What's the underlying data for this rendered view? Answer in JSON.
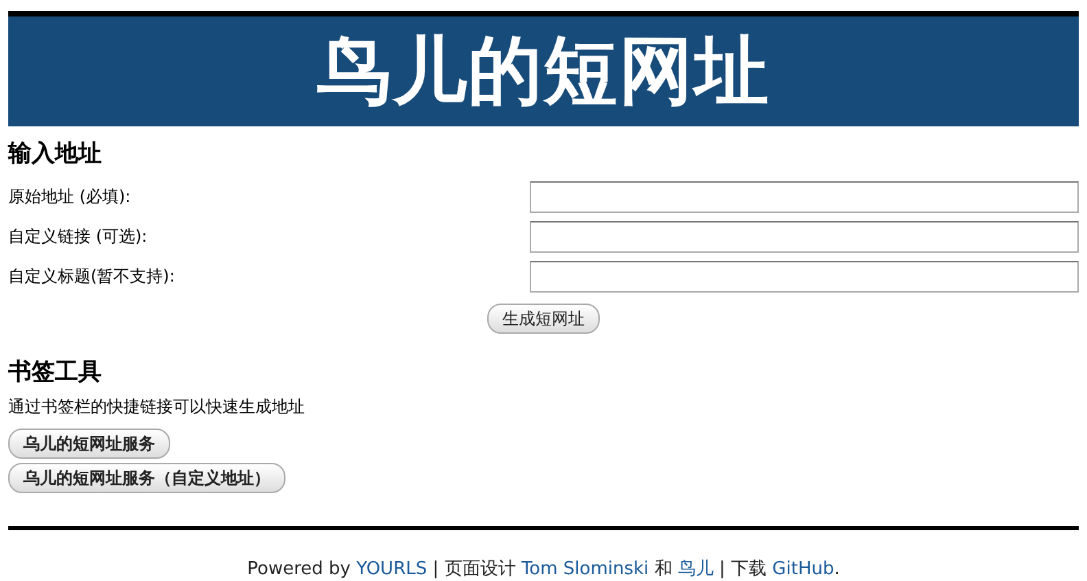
{
  "banner": {
    "title": "鸟儿的短网址"
  },
  "input_section": {
    "heading": "输入地址",
    "fields": [
      {
        "label": "原始地址 (必填):"
      },
      {
        "label": "自定义链接 (可选):"
      },
      {
        "label": "自定义标题(暂不支持):"
      }
    ],
    "submit": "生成短网址"
  },
  "bookmark_section": {
    "heading": "书签工具",
    "description": "通过书签栏的快捷链接可以快速生成地址",
    "buttons": [
      "乌儿的短网址服务",
      "乌儿的短网址服务（自定义地址）"
    ]
  },
  "footer": [
    {
      "kind": "text",
      "text": "Powered by "
    },
    {
      "kind": "link",
      "text": "YOURLS"
    },
    {
      "kind": "text",
      "text": " | 页面设计 "
    },
    {
      "kind": "link",
      "text": "Tom Slominski"
    },
    {
      "kind": "text",
      "text": " 和 "
    },
    {
      "kind": "link",
      "text": "鸟儿"
    },
    {
      "kind": "text",
      "text": " | 下载 "
    },
    {
      "kind": "link",
      "text": "GitHub"
    },
    {
      "kind": "text",
      "text": "."
    }
  ]
}
